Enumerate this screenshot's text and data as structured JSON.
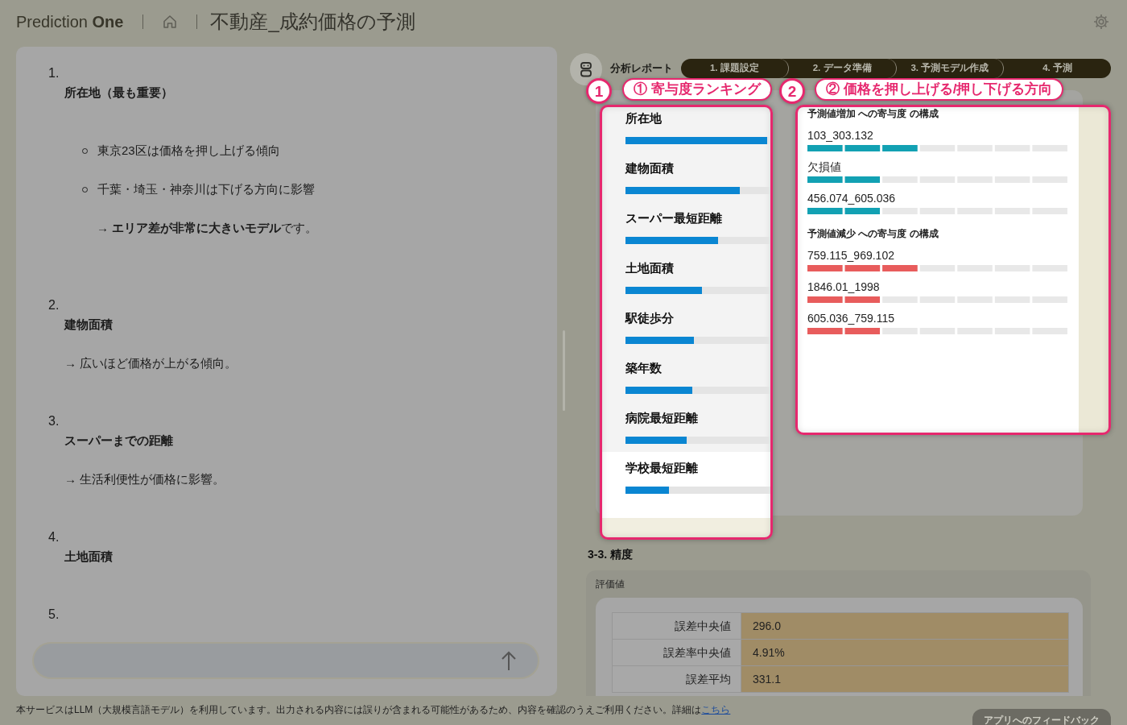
{
  "header": {
    "brand": "Prediction **One**",
    "title": "不動産_成約価格の予測"
  },
  "chat": {
    "items": [
      {
        "number": "1.",
        "title": "所在地（最も重要）",
        "bullets": [
          "東京23区は価格を押し上げる傾向",
          "千葉・埼玉・神奈川は下げる方向に影響"
        ],
        "bullet_note": "→ **エリア差が非常に大きいモデル**です。"
      },
      {
        "number": "2.",
        "title": "建物面積",
        "note": "→ 広いほど価格が上がる傾向。"
      },
      {
        "number": "3.",
        "title": "スーパーまでの距離",
        "note": "→ 生活利便性が価格に影響。"
      },
      {
        "number": "4.",
        "title": "土地面積"
      },
      {
        "number": "5."
      }
    ]
  },
  "report": {
    "label": "分析レポート",
    "steps": [
      {
        "label": "1. 課題設定"
      },
      {
        "label": "2. データ準備"
      },
      {
        "label": "3. 予測モデル作成"
      },
      {
        "label": "4. 予測"
      }
    ],
    "ranking": {
      "items": [
        {
          "name": "所在地",
          "level": 0.98
        },
        {
          "name": "建物面積",
          "level": 0.79
        },
        {
          "name": "スーパー最短距離",
          "level": 0.64
        },
        {
          "name": "土地面積",
          "level": 0.53
        },
        {
          "name": "駅徒歩分",
          "level": 0.47
        },
        {
          "name": "築年数",
          "level": 0.46
        },
        {
          "name": "病院最短距離",
          "level": 0.42
        },
        {
          "name": "学校最短距離",
          "level": 0.3
        }
      ]
    },
    "contribution": {
      "groups": [
        {
          "title": "予測値増加 への寄与度 の構成",
          "color": "#12a1b3",
          "items": [
            {
              "label": "103_303.132",
              "level": 0.43
            },
            {
              "label": "欠損値",
              "level": 0.29
            },
            {
              "label": "456.074_605.036",
              "level": 0.29
            }
          ]
        },
        {
          "title": "予測値減少 への寄与度 の構成",
          "color": "#e85c5c",
          "items": [
            {
              "label": "759.115_969.102",
              "level": 0.43
            },
            {
              "label": "1846.01_1998",
              "level": 0.29
            },
            {
              "label": "605.036_759.115",
              "level": 0.29
            }
          ]
        }
      ]
    },
    "accuracy": {
      "heading": "3-3. 精度",
      "label": "評価値",
      "rows": [
        {
          "metric": "誤差中央値",
          "value": "296.0"
        },
        {
          "metric": "誤差率中央値",
          "value": "4.91%"
        },
        {
          "metric": "誤差平均",
          "value": "331.1"
        }
      ]
    }
  },
  "callouts": [
    {
      "number": "1",
      "label": "① 寄与度ランキング"
    },
    {
      "number": "2",
      "label": "② 価格を押し上げる/押し下げる方向"
    }
  ],
  "footer": {
    "notice": "本サービスはLLM（大規模言語モデル）を利用しています。出力される内容には誤りが含まれる可能性があるため、内容を確認のうえご利用ください。詳細は",
    "link": "こちら",
    "feedback": "アプリへのフィードバック"
  }
}
